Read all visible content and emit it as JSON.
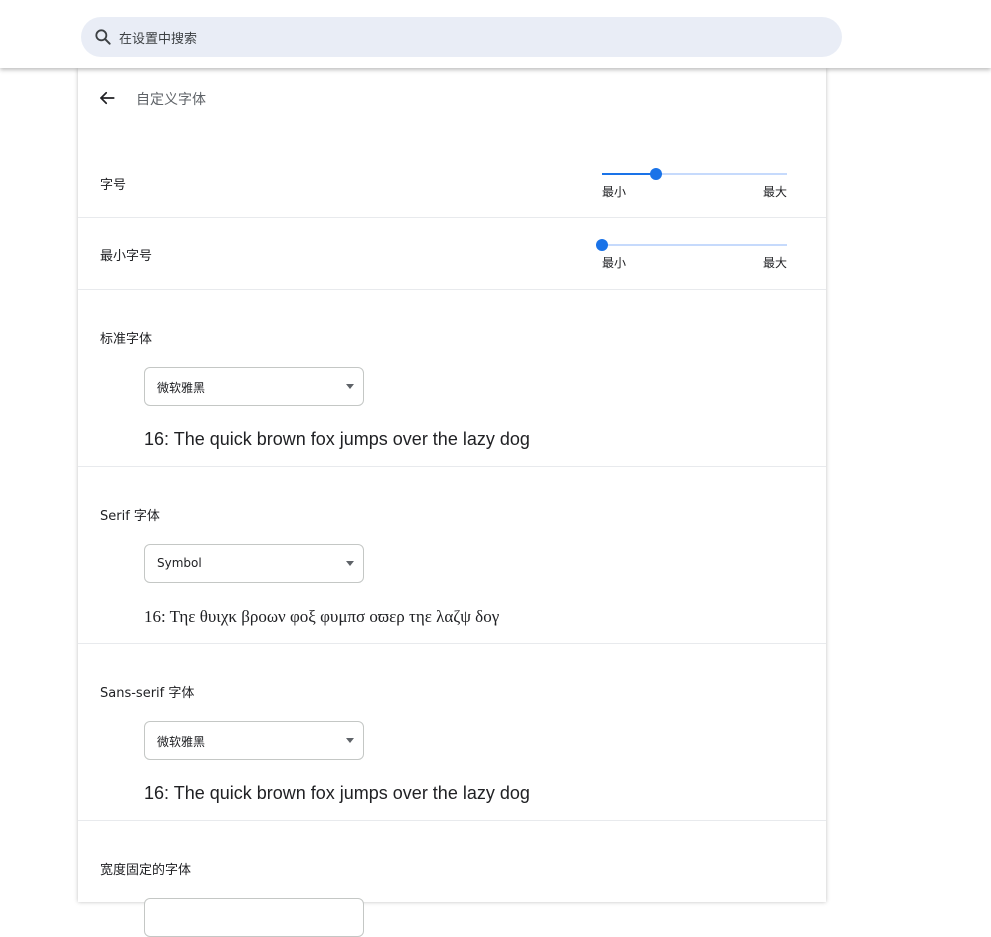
{
  "search": {
    "placeholder": "在设置中搜索",
    "icon": "search-icon"
  },
  "subpage": {
    "title": "自定义字体",
    "back_icon": "arrow-back-icon"
  },
  "font_size": {
    "label": "字号",
    "min_label": "最小",
    "max_label": "最大",
    "value_fraction": 0.29
  },
  "min_font_size": {
    "label": "最小字号",
    "min_label": "最小",
    "max_label": "最大",
    "value_fraction": 0.0
  },
  "standard_font": {
    "title": "标准字体",
    "selected": "微软雅黑",
    "sample": "16: The quick brown fox jumps over the lazy dog"
  },
  "serif_font": {
    "title": "Serif 字体",
    "selected": "Symbol",
    "sample": "16: Τηε θυιχκ βροων φοξ φυμπσ οϖερ τηε λαζψ δογ"
  },
  "sans_serif_font": {
    "title": "Sans-serif 字体",
    "selected": "微软雅黑",
    "sample": "16: The quick brown fox jumps over the lazy dog"
  },
  "fixed_width_font": {
    "title": "宽度固定的字体"
  },
  "colors": {
    "accent": "#1a73e8",
    "track": "#c6dafc",
    "search_bg": "#e9edf6"
  }
}
